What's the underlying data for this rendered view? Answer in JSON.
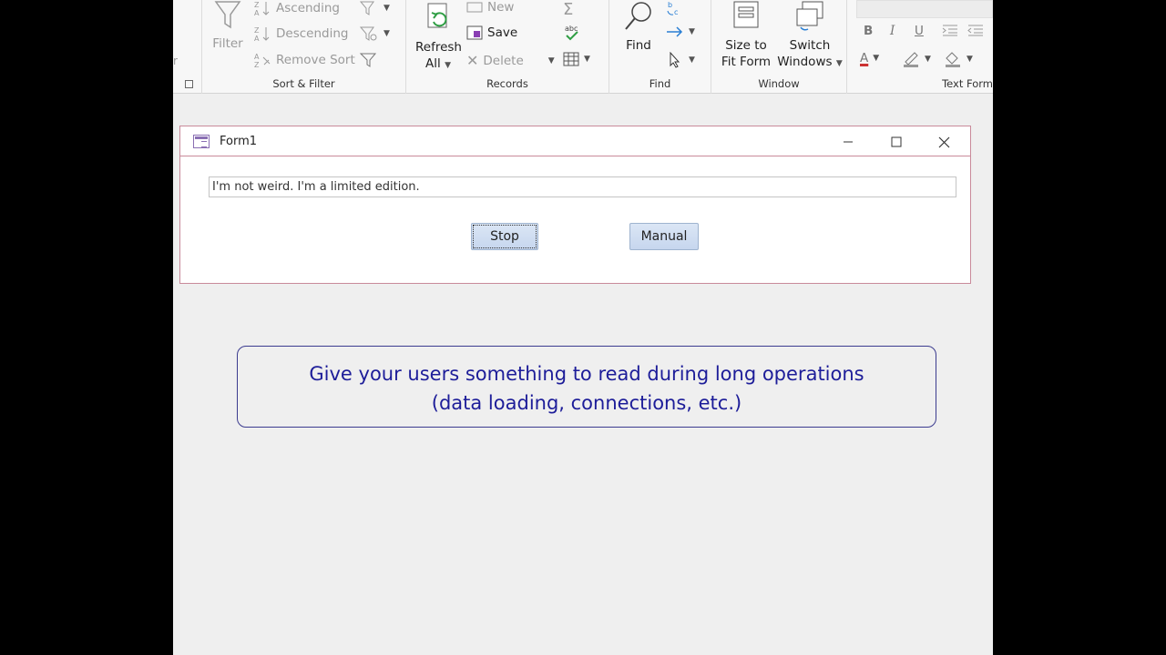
{
  "ribbon": {
    "sort_filter": {
      "label": "Sort & Filter",
      "filter": "Filter",
      "ascending": "Ascending",
      "descending": "Descending",
      "remove_sort": "Remove Sort"
    },
    "records": {
      "label": "Records",
      "refresh_line1": "Refresh",
      "refresh_line2": "All",
      "new": "New",
      "save": "Save",
      "delete": "Delete"
    },
    "find": {
      "label": "Find",
      "find": "Find"
    },
    "window": {
      "label": "Window",
      "size_line1": "Size to",
      "size_line2": "Fit Form",
      "switch_line1": "Switch",
      "switch_line2": "Windows"
    },
    "text_format": {
      "label": "Text Form",
      "bold": "B",
      "italic": "I",
      "underline": "U",
      "font_color_letter": "A"
    }
  },
  "form": {
    "title": "Form1",
    "message": "I'm not weird. I'm a limited edition.",
    "stop_label": "Stop",
    "manual_label": "Manual"
  },
  "caption": {
    "line1": "Give your users something to read during long operations",
    "line2": "(data loading, connections, etc.)"
  },
  "colors": {
    "form_border": "#c98a9a",
    "caption_text": "#1d1d99",
    "button_fill": "#c6d6ee"
  }
}
